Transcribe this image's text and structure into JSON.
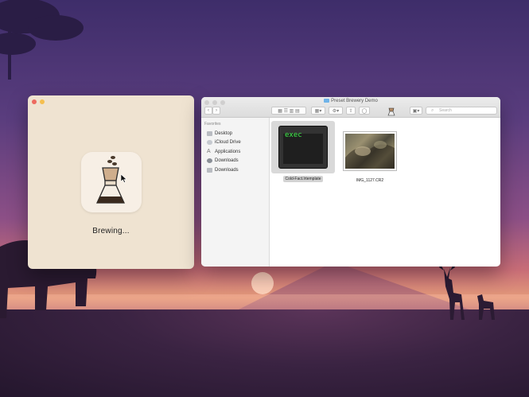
{
  "wallpaper": {
    "colors": {
      "sky_top": "#3e2d6a",
      "sunset": "#e39a7a",
      "ground": "#24162d"
    }
  },
  "brew_window": {
    "status_text": "Brewing...",
    "icon": "coffee-chemex-icon",
    "traffic_lights": [
      "close",
      "minimize"
    ]
  },
  "finder_window": {
    "title": "Preset Brewery Demo",
    "search_placeholder": "Search",
    "sidebar": {
      "heading": "Favorites",
      "items": [
        {
          "label": "Desktop",
          "icon": "desktop-icon"
        },
        {
          "label": "iCloud Drive",
          "icon": "cloud-icon"
        },
        {
          "label": "Applications",
          "icon": "applications-icon"
        },
        {
          "label": "Downloads",
          "icon": "downloads-icon"
        },
        {
          "label": "Downloads",
          "icon": "folder-icon"
        }
      ]
    },
    "files": [
      {
        "name": "Cold-Fact.lrtemplate",
        "thumb_text": "exec",
        "selected": true
      },
      {
        "name": "IMG_1127.CR2",
        "selected": false
      }
    ]
  }
}
